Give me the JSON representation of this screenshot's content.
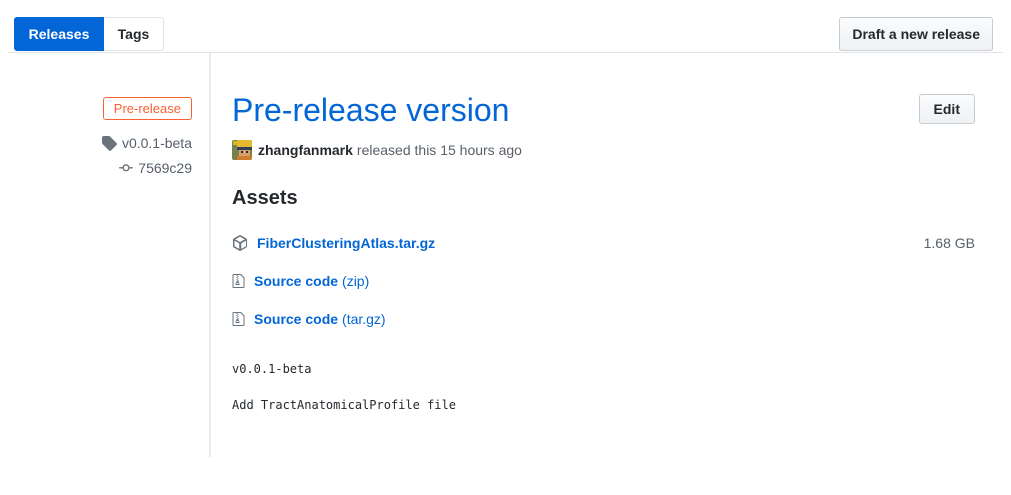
{
  "header": {
    "releases_tab": "Releases",
    "tags_tab": "Tags",
    "draft_button": "Draft a new release"
  },
  "sidebar": {
    "prerelease_badge": "Pre-release",
    "tag_name": "v0.0.1-beta",
    "commit_sha": "7569c29"
  },
  "release": {
    "title": "Pre-release version",
    "edit_button": "Edit",
    "author": "zhangfanmark",
    "released_text": "released this 15 hours ago",
    "assets_heading": "Assets",
    "assets": [
      {
        "icon": "package-icon",
        "name": "FiberClusteringAtlas.tar.gz",
        "size": "1.68 GB"
      },
      {
        "icon": "file-zip-icon",
        "name": "Source code",
        "suffix": "(zip)"
      },
      {
        "icon": "file-zip-icon",
        "name": "Source code",
        "suffix": "(tar.gz)"
      }
    ],
    "description_lines": [
      "v0.0.1-beta",
      "Add TractAnatomicalProfile file"
    ]
  },
  "colors": {
    "accent_blue": "#0366d6",
    "prerelease_orange": "#fa6032",
    "text_dark": "#24292e",
    "text_gray": "#586069",
    "border_gray": "#e1e4e8"
  }
}
